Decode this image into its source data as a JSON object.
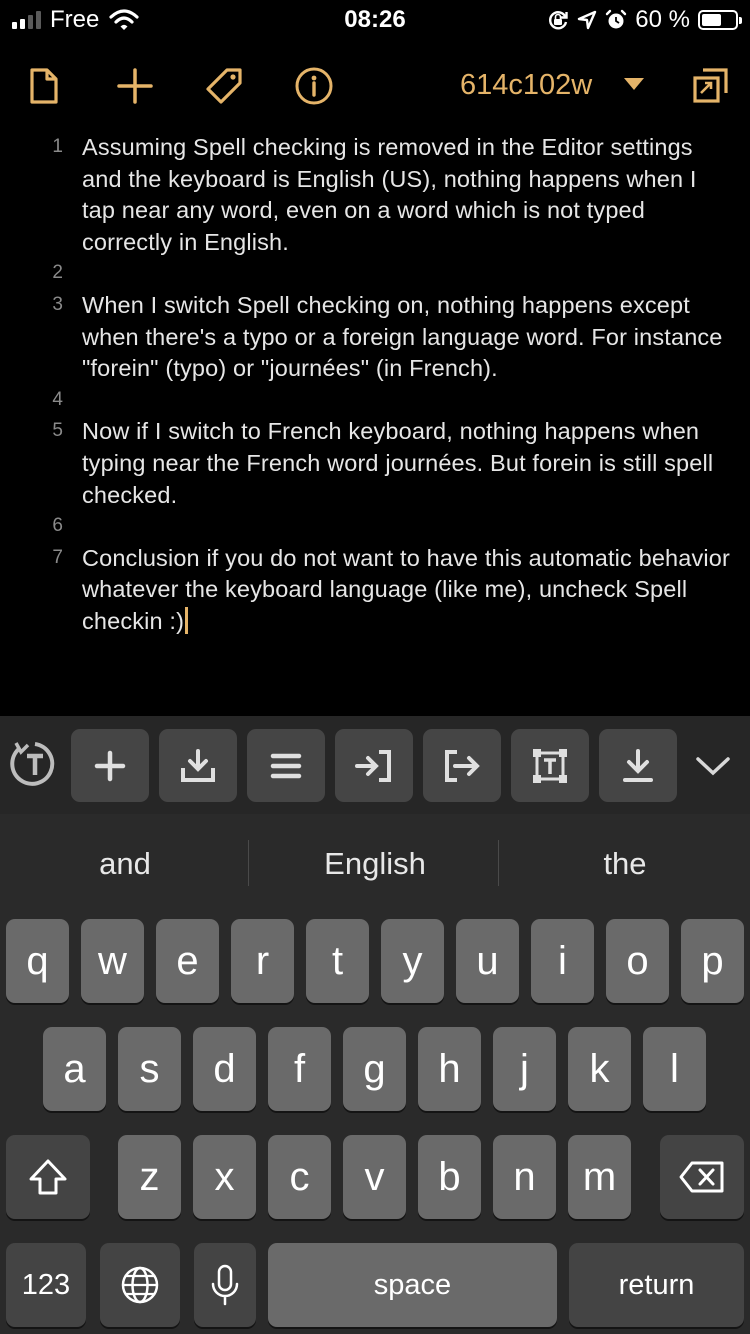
{
  "status_bar": {
    "carrier": "Free",
    "time": "08:26",
    "battery_percent": "60 %",
    "battery_level": 0.6,
    "icons": [
      "signal-bars-icon",
      "wifi-icon",
      "rotation-lock-icon",
      "location-icon",
      "alarm-icon",
      "battery-icon"
    ]
  },
  "toolbar": {
    "document_name": "614c102w",
    "icons": [
      "document-icon",
      "plus-icon",
      "tag-icon",
      "info-icon",
      "chevron-down-icon",
      "duplicate-icon"
    ],
    "accent_color": "#e5b469"
  },
  "editor": {
    "lines": [
      {
        "number": "1",
        "text": "Assuming Spell checking is removed in the Editor settings and the keyboard is English (US), nothing happens when I tap near any word, even on a word which is not typed correctly in English."
      },
      {
        "number": "2",
        "text": ""
      },
      {
        "number": "3",
        "text": "When I switch Spell checking on, nothing happens except when there's a typo or a foreign language word. For instance \"forein\" (typo) or \"journées\" (in French)."
      },
      {
        "number": "4",
        "text": ""
      },
      {
        "number": "5",
        "text": "Now if I switch to French keyboard, nothing happens when typing near the French word journées. But forein is still spell checked."
      },
      {
        "number": "6",
        "text": ""
      },
      {
        "number": "7",
        "text": "Conclusion if you do not want to have this automatic behavior whatever the keyboard language (like me), uncheck Spell checkin :)"
      }
    ]
  },
  "accessory_bar": {
    "buttons": [
      "text-style-icon",
      "plus-icon",
      "download-tray-icon",
      "align-icon",
      "indent-icon",
      "outdent-icon",
      "text-box-icon",
      "download-icon",
      "chevron-down-icon"
    ]
  },
  "predictions": [
    "and",
    "English",
    "the"
  ],
  "keyboard": {
    "row1": [
      "q",
      "w",
      "e",
      "r",
      "t",
      "y",
      "u",
      "i",
      "o",
      "p"
    ],
    "row2": [
      "a",
      "s",
      "d",
      "f",
      "g",
      "h",
      "j",
      "k",
      "l"
    ],
    "row3": [
      "z",
      "x",
      "c",
      "v",
      "b",
      "n",
      "m"
    ],
    "numbers_label": "123",
    "space_label": "space",
    "return_label": "return"
  }
}
